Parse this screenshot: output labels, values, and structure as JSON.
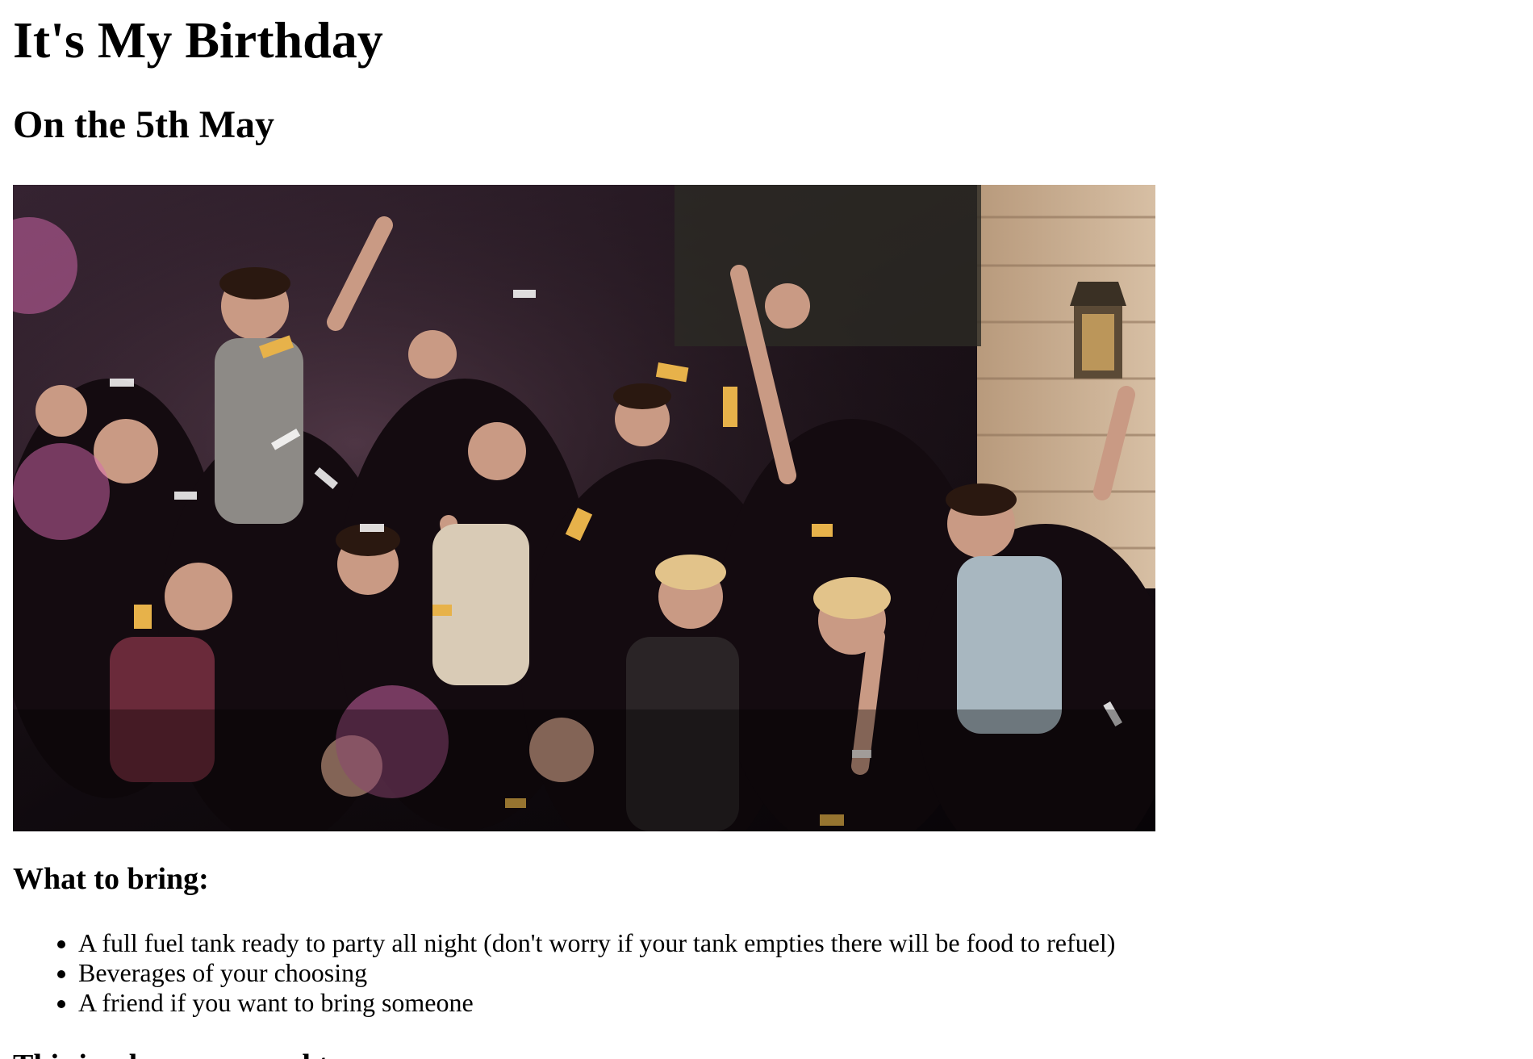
{
  "page": {
    "title": "It's My Birthday",
    "subtitle": "On the 5th May",
    "bring_heading": "What to bring:",
    "bring_items": [
      "A full fuel tank ready to party all night (don't worry if your tank empties there will be food to refuel)",
      "Beverages of your choosing",
      "A friend if you want to bring someone"
    ],
    "where_heading": "This is where you need to go:"
  }
}
